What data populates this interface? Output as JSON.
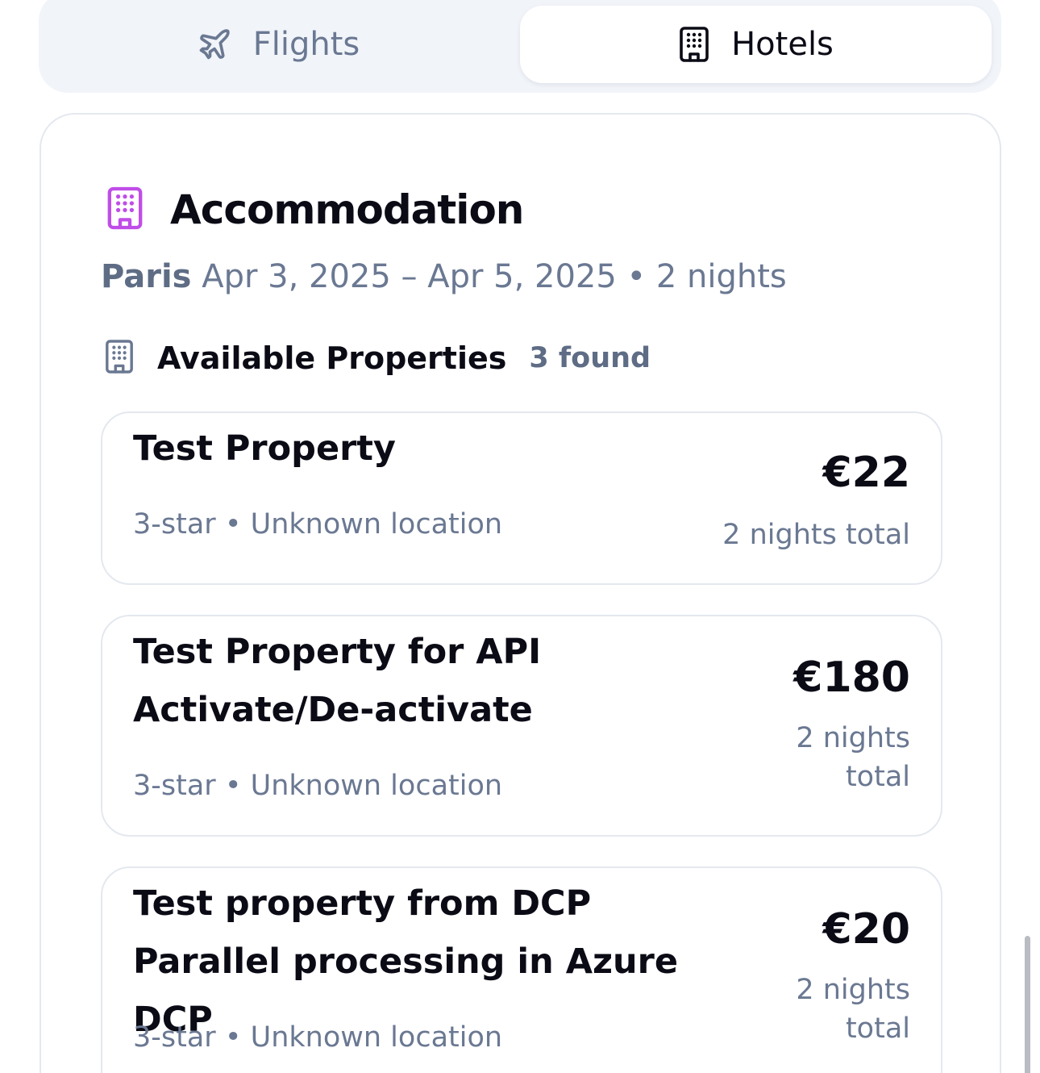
{
  "tabs": {
    "flights_label": "Flights",
    "hotels_label": "Hotels",
    "active": "Hotels"
  },
  "accommodation": {
    "title": "Accommodation",
    "city": "Paris",
    "dates": "Apr 3, 2025 – Apr 5, 2025 • 2 nights",
    "icon_color": "#c04de8"
  },
  "properties": {
    "heading": "Available Properties",
    "count_label": "3 found",
    "items": [
      {
        "name": "Test Property",
        "details": "3-star • Unknown location",
        "price": "€22",
        "total_label": "2 nights total"
      },
      {
        "name": "Test Property for API Activate/De-activate",
        "details": "3-star • Unknown location",
        "price": "€180",
        "total_label": "2 nights total"
      },
      {
        "name": "Test property from DCP Parallel processing in Azure DCP",
        "details": "3-star • Unknown location",
        "price": "€20",
        "total_label": "2 nights total"
      }
    ]
  }
}
